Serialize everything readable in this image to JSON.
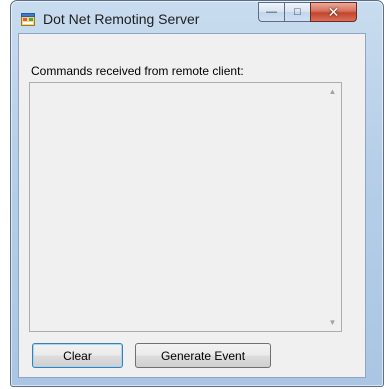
{
  "window": {
    "title": "Dot Net Remoting Server",
    "icon": "application-form-icon",
    "caption_buttons": {
      "minimize": "—",
      "maximize": "□",
      "close": "✕"
    }
  },
  "form": {
    "commands_label": "Commands received from remote client:",
    "commands_text": "",
    "scroll_up_glyph": "▲",
    "scroll_down_glyph": "▼",
    "clear_label": "Clear",
    "generate_event_label": "Generate Event"
  },
  "colors": {
    "frame": "#b7cfe8",
    "client_background": "#f0f0f0",
    "close_button": "#c5442a"
  }
}
